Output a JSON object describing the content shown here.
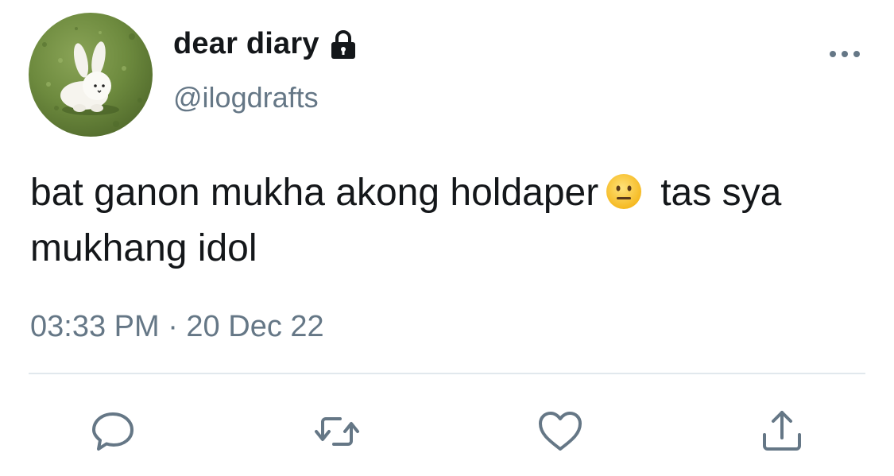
{
  "tweet": {
    "display_name": "dear diary",
    "handle": "@ilogdrafts",
    "text_part1": "bat ganon mukha akong holdaper",
    "text_part2": "tas sya mukhang idol",
    "emoji_name": "neutral-face-emoji",
    "timestamp": "03:33 PM · 20 Dec 22"
  },
  "icons": {
    "lock": "lock-icon",
    "more": "more-dots-icon",
    "reply": "reply-icon",
    "retweet": "retweet-icon",
    "like": "heart-icon",
    "share": "share-icon"
  },
  "colors": {
    "text": "#14171a",
    "secondary": "#657786",
    "divider": "#e1e8ed",
    "action_icons": "#657786"
  }
}
